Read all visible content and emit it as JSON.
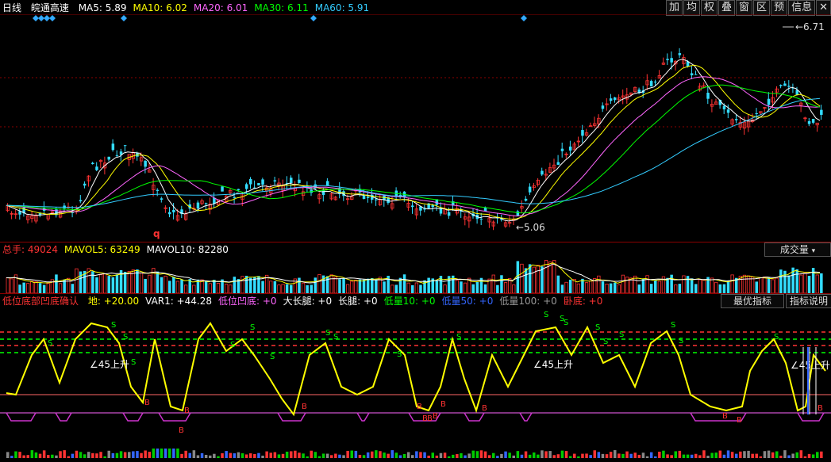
{
  "header": {
    "period": "日线",
    "stock_name": "皖通高速",
    "ma": [
      {
        "label": "MA5: 5.89",
        "color": "#ffffff"
      },
      {
        "label": "MA10: 6.02",
        "color": "#ffff00"
      },
      {
        "label": "MA20: 6.01",
        "color": "#ff66ff"
      },
      {
        "label": "MA30: 6.11",
        "color": "#00ff00"
      },
      {
        "label": "MA60: 5.91",
        "color": "#33ccff"
      }
    ]
  },
  "toolbar": [
    "加",
    "均",
    "权",
    "叠",
    "窗",
    "区",
    "预",
    "信息",
    "✕"
  ],
  "price_pane": {
    "high_label": "6.71",
    "low_label": "5.06"
  },
  "volume_pane": {
    "items": [
      {
        "label": "总手: 49024",
        "color": "#ff3333"
      },
      {
        "label": "MAVOL5: 63249",
        "color": "#ffff00"
      },
      {
        "label": "MAVOL10: 82280",
        "color": "#ffffff"
      }
    ],
    "dropdown": "成交量"
  },
  "indicator_pane": {
    "title": "低位底部凹底确认",
    "items": [
      {
        "label": "地: +20.00",
        "color": "#ffff00"
      },
      {
        "label": "VAR1: +44.28",
        "color": "#ffffff"
      },
      {
        "label": "低位凹底: +0",
        "color": "#ff66ff"
      },
      {
        "label": "大长腿: +0",
        "color": "#ffffff"
      },
      {
        "label": "长腿: +0",
        "color": "#ffffff"
      },
      {
        "label": "低量10: +0",
        "color": "#00ff00"
      },
      {
        "label": "低量50: +0",
        "color": "#3366ff"
      },
      {
        "label": "低量100: +0",
        "color": "#999999"
      },
      {
        "label": "卧底: +0",
        "color": "#ff3333"
      }
    ],
    "btn_best": "最优指标",
    "btn_help": "指标说明",
    "marker_s": "S",
    "marker_b": "B",
    "rise_label": "∠45上升"
  },
  "colors": {
    "up": "#ff3333",
    "down": "#33ddff",
    "grid": "#8b0000"
  }
}
